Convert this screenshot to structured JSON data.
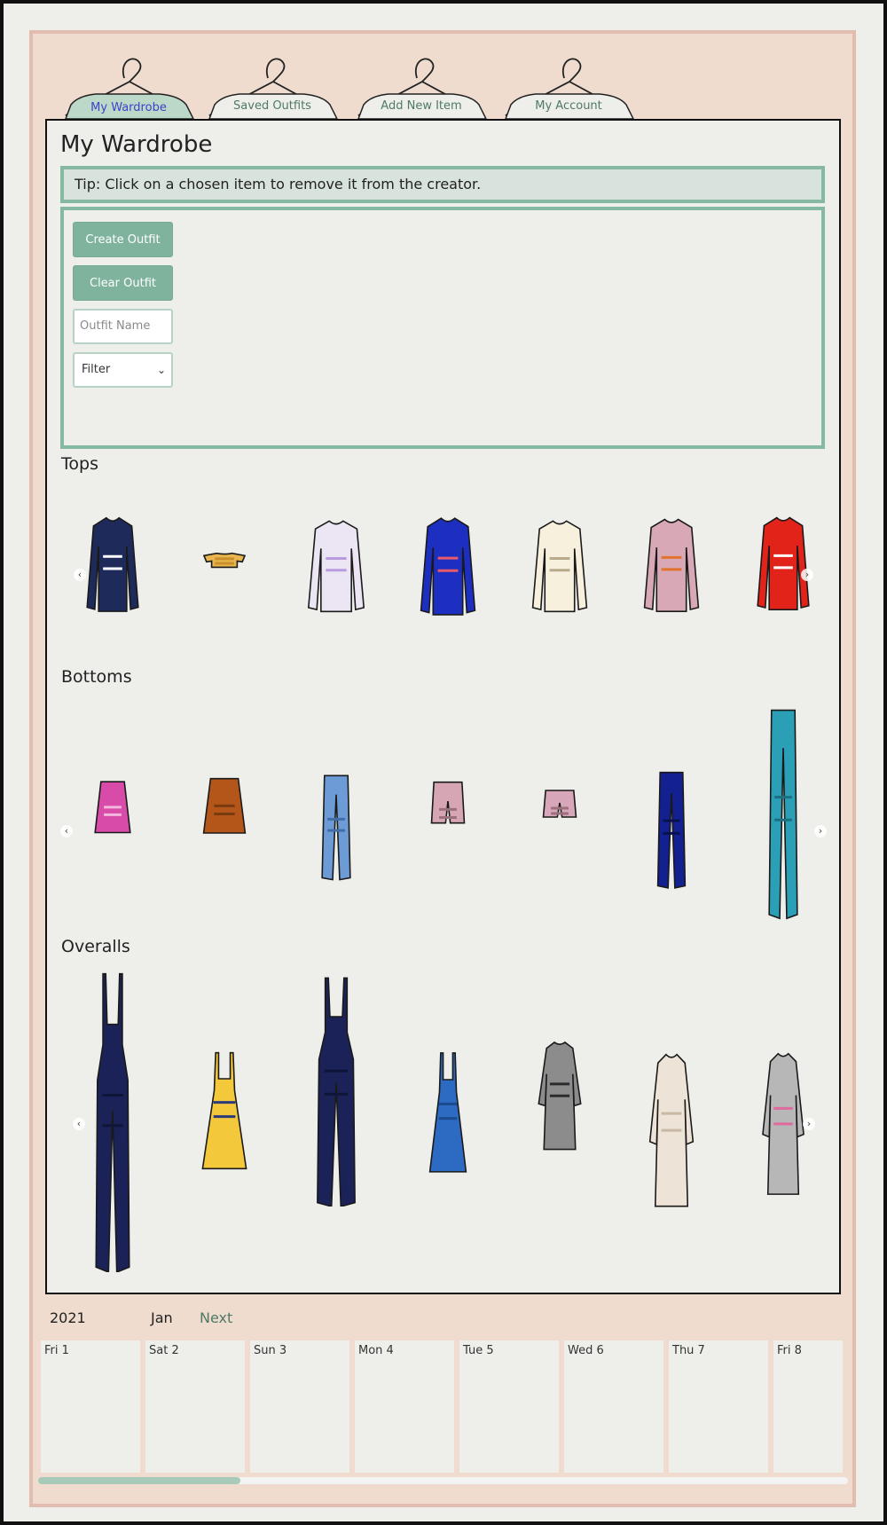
{
  "tabs": [
    {
      "label": "My Wardrobe",
      "active": true
    },
    {
      "label": "Saved Outfits",
      "active": false
    },
    {
      "label": "Add New Item",
      "active": false
    },
    {
      "label": "My Account",
      "active": false
    }
  ],
  "page": {
    "title": "My Wardrobe",
    "tip": "Tip: Click on a chosen item to remove it from the creator."
  },
  "creator": {
    "create_label": "Create Outfit",
    "clear_label": "Clear Outfit",
    "name_placeholder": "Outfit Name",
    "filter_value": "Filter"
  },
  "sections": {
    "tops": {
      "title": "Tops",
      "items": [
        {
          "icon": "striped-long-sleeve-top-icon",
          "color": "#1e2b5a",
          "accent": "#ffffff"
        },
        {
          "icon": "yellow-crop-top-icon",
          "color": "#e8b54e",
          "accent": "#c98f2a"
        },
        {
          "icon": "lilac-sweater-icon",
          "color": "#ece6f4",
          "accent": "#b99be0"
        },
        {
          "icon": "blue-superdry-sweater-icon",
          "color": "#1d2fc0",
          "accent": "#e85a6a"
        },
        {
          "icon": "cream-superdry-sweater-icon",
          "color": "#f6f0dd",
          "accent": "#b8a98a"
        },
        {
          "icon": "pink-rainbow-sweater-icon",
          "color": "#d8a8b6",
          "accent": "#e0732e"
        },
        {
          "icon": "red-superdry-sweater-icon",
          "color": "#e2231a",
          "accent": "#ffffff"
        }
      ]
    },
    "bottoms": {
      "title": "Bottoms",
      "items": [
        {
          "icon": "pink-floral-skirt-icon",
          "color": "#d94ba8",
          "accent": "#f4b7dd"
        },
        {
          "icon": "rust-skirt-icon",
          "color": "#b4561a",
          "accent": "#7a3a10"
        },
        {
          "icon": "light-blue-jeans-icon",
          "color": "#6c9bd6",
          "accent": "#3f6ea8"
        },
        {
          "icon": "pink-shorts-icon",
          "color": "#d7a6b5",
          "accent": "#9c6f7c"
        },
        {
          "icon": "pink-lounge-shorts-icon",
          "color": "#d7a6b8",
          "accent": "#9c6f7c"
        },
        {
          "icon": "navy-jeans-icon",
          "color": "#13208f",
          "accent": "#0a1150"
        },
        {
          "icon": "teal-jeans-icon",
          "color": "#2a9fb5",
          "accent": "#1b6f80"
        }
      ]
    },
    "overalls": {
      "title": "Overalls",
      "items": [
        {
          "icon": "navy-dungarees-icon",
          "color": "#1a2257",
          "accent": "#0f1538"
        },
        {
          "icon": "plaid-pinafore-dress-icon",
          "color": "#f3c83a",
          "accent": "#2a3a7a"
        },
        {
          "icon": "navy-jumpsuit-icon",
          "color": "#1a2257",
          "accent": "#0f1538"
        },
        {
          "icon": "blue-pinafore-dress-icon",
          "color": "#2d6bc2",
          "accent": "#1b4b8f"
        },
        {
          "icon": "graffiti-shirt-dress-icon",
          "color": "#8c8c8c",
          "accent": "#2b2b2b"
        },
        {
          "icon": "cream-sweater-dress-icon",
          "color": "#ede3d6",
          "accent": "#c9b8a4"
        },
        {
          "icon": "grey-superdry-sweater-dress-icon",
          "color": "#b7b7b7",
          "accent": "#e06a9e"
        }
      ]
    }
  },
  "calendar": {
    "year": "2021",
    "month": "Jan",
    "next_label": "Next",
    "days": [
      "Fri 1",
      "Sat 2",
      "Sun 3",
      "Mon 4",
      "Tue 5",
      "Wed 6",
      "Thu 7",
      "Fri 8"
    ]
  },
  "colors": {
    "accent": "#7fb39d",
    "tip_border": "#86b9a1",
    "board_bg": "#efdccf",
    "active_tab_text": "#3b43c8"
  }
}
